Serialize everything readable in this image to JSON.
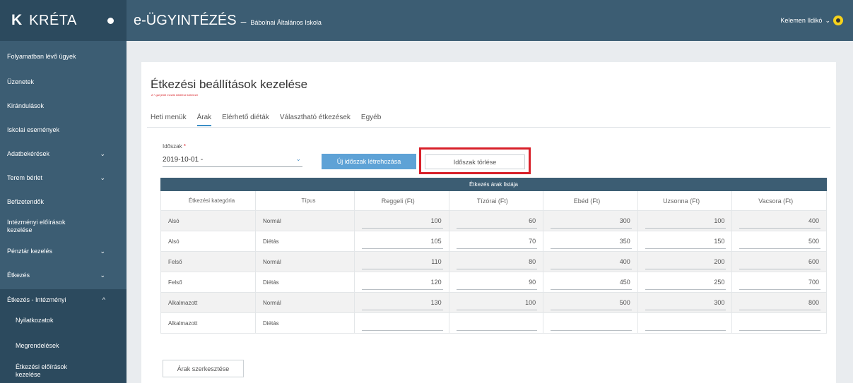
{
  "brand": {
    "logo": "K",
    "name": "KRÉTA"
  },
  "header": {
    "app": "e-ÜGYINTÉZÉS",
    "separator": "–",
    "school": "Bábolnai Általános Iskola",
    "user": "Kelemen Ildikó",
    "user_chevron": "⌄"
  },
  "sidebar": {
    "items": [
      {
        "label": "Folyamatban lévő ügyek"
      },
      {
        "label": "Üzenetek"
      },
      {
        "label": "Kirándulások"
      },
      {
        "label": "Iskolai események"
      },
      {
        "label": "Adatbekérések",
        "chevron": "⌄"
      },
      {
        "label": "Terem bérlet",
        "chevron": "⌄"
      },
      {
        "label": "Befizetendők"
      },
      {
        "label": "Intézményi előírások kezelése"
      },
      {
        "label": "Pénztár kezelés",
        "chevron": "⌄"
      },
      {
        "label": "Étkezés",
        "chevron": "⌄"
      },
      {
        "label": "Étkezés - Intézményi",
        "chevron": "^"
      }
    ],
    "sub_items": [
      {
        "label": "Nyilatkozatok"
      },
      {
        "label": "Megrendelések"
      },
      {
        "label": "Étkezési előírások kezelése"
      }
    ]
  },
  "page": {
    "title": "Étkezési beállítások kezelése",
    "note": "A *-gal jelölt mezők kitöltése kötelező",
    "tabs": [
      {
        "label": "Heti menük"
      },
      {
        "label": "Árak"
      },
      {
        "label": "Elérhető diéták"
      },
      {
        "label": "Választható étkezések"
      },
      {
        "label": "Egyéb"
      }
    ],
    "period_label": "Időszak",
    "required_mark": "*",
    "period_value": "2019-10-01 -",
    "select_arrow": "⌄",
    "new_period_button": "Új időszak létrehozása",
    "delete_period_button": "Időszak törlése",
    "edit_prices_button": "Árak szerkesztése"
  },
  "table": {
    "title": "Étkezés árak listája",
    "columns": [
      "Étkezési kategória",
      "Típus",
      "Reggeli (Ft)",
      "Tízórai (Ft)",
      "Ebéd (Ft)",
      "Uzsonna (Ft)",
      "Vacsora (Ft)"
    ],
    "rows": [
      {
        "category": "Alsó",
        "type": "Normál",
        "v": [
          "100",
          "60",
          "300",
          "100",
          "400"
        ]
      },
      {
        "category": "Alsó",
        "type": "Diétás",
        "v": [
          "105",
          "70",
          "350",
          "150",
          "500"
        ]
      },
      {
        "category": "Felső",
        "type": "Normál",
        "v": [
          "110",
          "80",
          "400",
          "200",
          "600"
        ]
      },
      {
        "category": "Felső",
        "type": "Diétás",
        "v": [
          "120",
          "90",
          "450",
          "250",
          "700"
        ]
      },
      {
        "category": "Alkalmazott",
        "type": "Normál",
        "v": [
          "130",
          "100",
          "500",
          "300",
          "800"
        ]
      },
      {
        "category": "Alkalmazott",
        "type": "Diétás",
        "v": [
          "",
          "",
          "",
          "",
          ""
        ]
      }
    ]
  },
  "colors": {
    "sidebar": "#3c5d73",
    "primary": "#5ea2d6",
    "highlight": "#d8202a"
  }
}
